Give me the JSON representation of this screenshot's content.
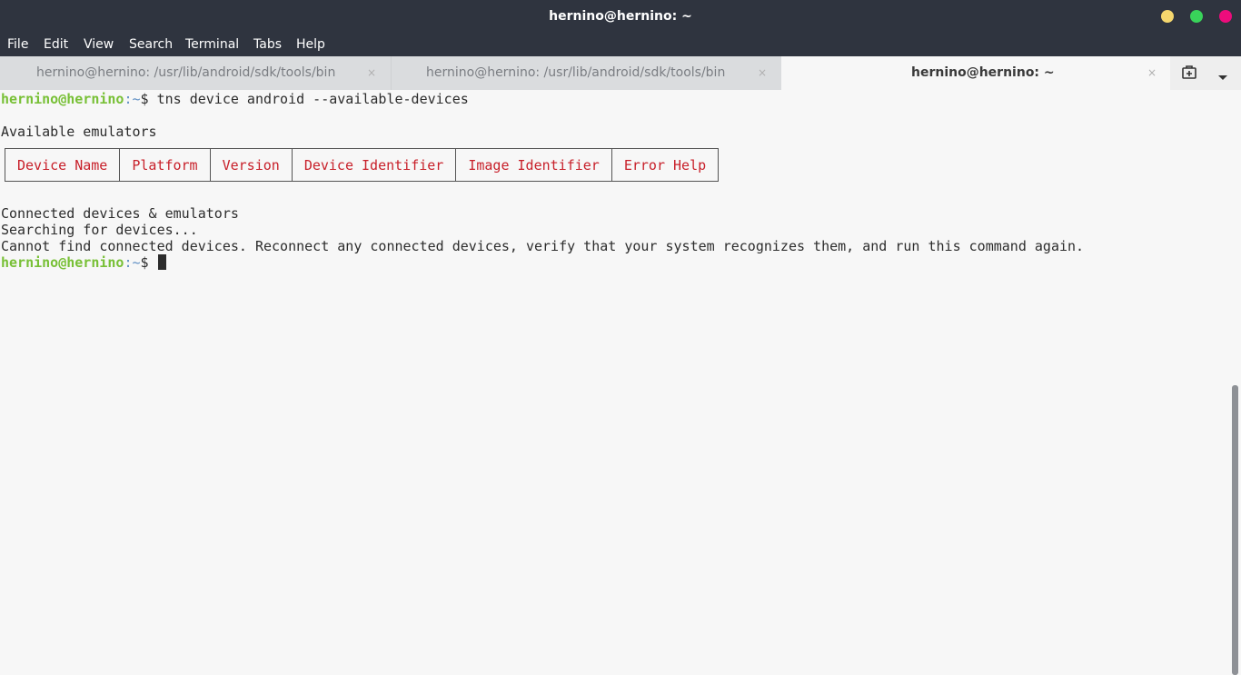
{
  "window": {
    "title": "hernino@hernino: ~",
    "controls": {
      "minimize_color": "#f5d76e",
      "maximize_color": "#39d35a",
      "close_color": "#ed0c7c"
    }
  },
  "menubar": {
    "items": [
      "File",
      "Edit",
      "View",
      "Search",
      "Terminal",
      "Tabs",
      "Help"
    ]
  },
  "tabs": [
    {
      "label": "hernino@hernino: /usr/lib/android/sdk/tools/bin",
      "close": "×",
      "active": false
    },
    {
      "label": "hernino@hernino: /usr/lib/android/sdk/tools/bin",
      "close": "×",
      "active": false
    },
    {
      "label": "hernino@hernino: ~",
      "close": "×",
      "active": true
    }
  ],
  "tab_actions": {
    "new_tab_icon": "new-tab-icon",
    "menu_icon": "chevron-down-icon"
  },
  "terminal": {
    "prompt": {
      "user": "hernino@hernino",
      "sep": ":~",
      "sign": "$"
    },
    "command": " tns device android --available-devices",
    "available_heading": "Available emulators",
    "table_headers": [
      "Device Name",
      "Platform",
      "Version",
      "Device Identifier",
      "Image Identifier",
      "Error Help"
    ],
    "connected_heading": "Connected devices & emulators",
    "searching": "Searching for devices...",
    "error_message": "Cannot find connected devices. Reconnect any connected devices, verify that your system recognizes them, and run this command again."
  },
  "colors": {
    "prompt_user": "#78c036",
    "prompt_path": "#5f8fc4",
    "table_header_text": "#c8202a",
    "titlebar_bg": "#2f343f"
  }
}
